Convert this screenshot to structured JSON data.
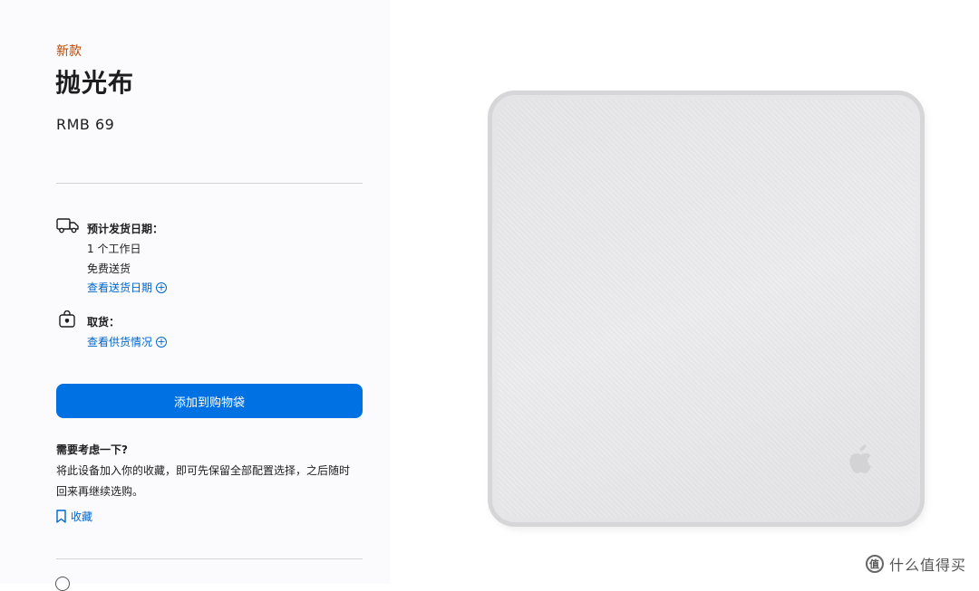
{
  "product": {
    "badge": "新款",
    "title": "抛光布",
    "price": "RMB 69"
  },
  "delivery": {
    "icon": "truck-icon",
    "heading": "预计发货日期：",
    "line1": "1 个工作日",
    "line2": "免费送货",
    "link": "查看送货日期"
  },
  "pickup": {
    "icon": "shopping-bag-icon",
    "heading": "取货：",
    "link": "查看供货情况"
  },
  "cart": {
    "button_label": "添加到购物袋"
  },
  "consider": {
    "heading": "需要考虑一下?",
    "text": "将此设备加入你的收藏，即可先保留全部配置选择，之后随时回来再继续选购。",
    "save_label": "收藏"
  },
  "watermark": {
    "icon": "值",
    "text": "什么值得买"
  },
  "colors": {
    "accent_blue": "#0071e3",
    "link_blue": "#0066cc",
    "badge_orange": "#b64400"
  }
}
